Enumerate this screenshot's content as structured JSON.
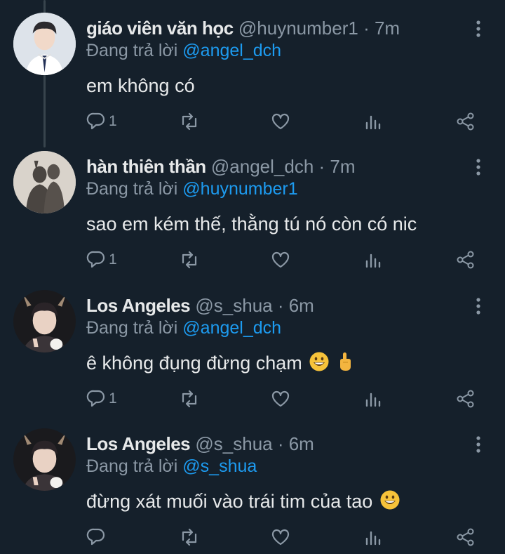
{
  "tweets": [
    {
      "name": "giáo viên văn học",
      "handle": "@huynumber1",
      "time": "· 7m",
      "reply_prefix": "Đang trả lời",
      "reply_to": "@angel_dch",
      "text": "em không có",
      "reply_count": "1",
      "emojis": []
    },
    {
      "name": "hàn thiên thần",
      "handle": "@angel_dch",
      "time": "· 7m",
      "reply_prefix": "Đang trả lời",
      "reply_to": "@huynumber1",
      "text": "sao em kém thế, thằng tú nó còn có nic",
      "reply_count": "1",
      "emojis": []
    },
    {
      "name": "Los Angeles",
      "handle": "@s_shua",
      "time": "· 6m",
      "reply_prefix": "Đang trả lời",
      "reply_to": "@angel_dch",
      "text": "ê không đụng đừng chạm",
      "reply_count": "1",
      "emojis": [
        "grinning-face-emoji",
        "middle-finger-emoji"
      ]
    },
    {
      "name": "Los Angeles",
      "handle": "@s_shua",
      "time": "· 6m",
      "reply_prefix": "Đang trả lời",
      "reply_to": "@s_shua",
      "text": "đừng xát muối vào trái tim của tao",
      "reply_count": "",
      "emojis": [
        "grinning-face-emoji"
      ]
    }
  ],
  "colors": {
    "background": "#15202b",
    "text": "#e7e9ea",
    "muted": "#8b98a5",
    "accent": "#1d9bf0",
    "thread_line": "#38444d"
  },
  "icons": [
    "reply-icon",
    "retweet-icon",
    "like-icon",
    "views-icon",
    "share-icon",
    "more-icon"
  ]
}
